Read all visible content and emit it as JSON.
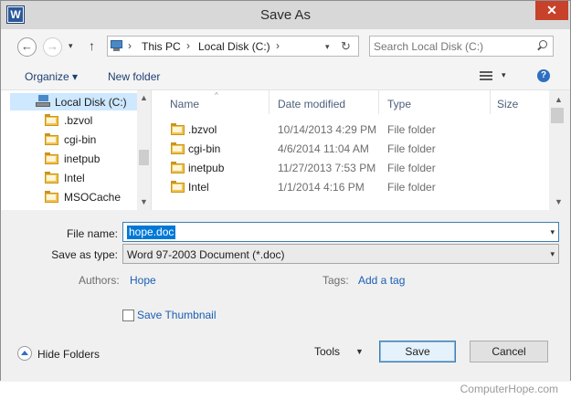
{
  "window": {
    "title": "Save As",
    "app_icon": "W",
    "close_glyph": "✕"
  },
  "navigation": {
    "back_glyph": "←",
    "forward_glyph": "→",
    "up_glyph": "↑",
    "address_segments": [
      "This PC",
      "Local Disk (C:)"
    ],
    "separator": "›",
    "refresh_glyph": "↻",
    "search_placeholder": "Search Local Disk (C:)"
  },
  "toolbar": {
    "organize_label": "Organize ▾",
    "new_folder_label": "New folder",
    "help_glyph": "?"
  },
  "nav_pane": {
    "selected": "Local Disk (C:)",
    "items": [
      ".bzvol",
      "cgi-bin",
      "inetpub",
      "Intel",
      "MSOCache"
    ]
  },
  "file_list": {
    "columns": {
      "name": "Name",
      "date": "Date modified",
      "type": "Type",
      "size": "Size"
    },
    "rows": [
      {
        "name": ".bzvol",
        "date": "10/14/2013 4:29 PM",
        "type": "File folder"
      },
      {
        "name": "cgi-bin",
        "date": "4/6/2014 11:04 AM",
        "type": "File folder"
      },
      {
        "name": "inetpub",
        "date": "11/27/2013 7:53 PM",
        "type": "File folder"
      },
      {
        "name": "Intel",
        "date": "1/1/2014 4:16 PM",
        "type": "File folder"
      }
    ]
  },
  "form": {
    "file_name_label": "File name:",
    "file_name_value": "hope.doc",
    "save_type_label": "Save as type:",
    "save_type_value": "Word 97-2003 Document (*.doc)",
    "authors_label": "Authors:",
    "authors_value": "Hope",
    "tags_label": "Tags:",
    "tags_value": "Add a tag",
    "thumbnail_label": "Save Thumbnail",
    "thumbnail_checked": false
  },
  "footer": {
    "hide_folders_label": "Hide Folders",
    "tools_label": "Tools",
    "save_label": "Save",
    "cancel_label": "Cancel"
  },
  "watermark": "ComputerHope.com",
  "colors": {
    "accent": "#0078d7",
    "close": "#c7412b",
    "link": "#1a5fb4",
    "selection": "#cde8ff"
  }
}
